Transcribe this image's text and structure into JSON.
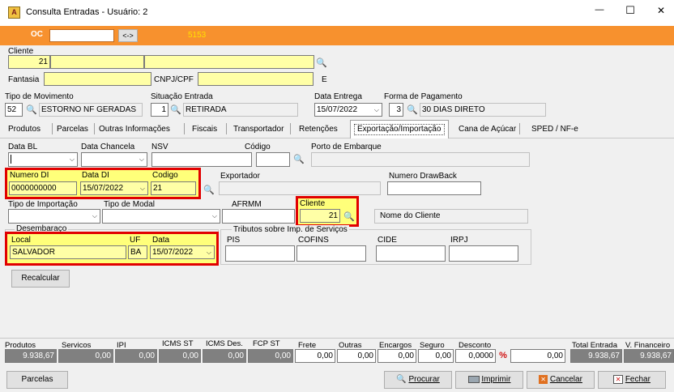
{
  "window": {
    "title": "Consulta Entradas - Usuário: 2",
    "controls": {
      "minimize": "—",
      "maximize": "☐",
      "close": "✕"
    }
  },
  "topbar": {
    "oc_label": "OC",
    "oc_button": "<->",
    "oc_number": "5153",
    "color": "#f7912e"
  },
  "client": {
    "section_label": "Cliente",
    "code": "21",
    "name": "",
    "fantasia_label": "Fantasia",
    "fantasia": "",
    "cnpj_label": "CNPJ/CPF",
    "cnpj": "",
    "e_label": "E"
  },
  "movement": {
    "tipo_label": "Tipo  de Movimento",
    "tipo_code": "52",
    "tipo_desc": "ESTORNO NF GERADAS",
    "situacao_label": "Situação Entrada",
    "situacao_code": "1",
    "situacao_desc": "RETIRADA",
    "data_entrega_label": "Data Entrega",
    "data_entrega": "15/07/2022",
    "forma_pag_label": "Forma de Pagamento",
    "forma_pag_code": "3",
    "forma_pag_desc": "30 DIAS DIRETO"
  },
  "tabs": [
    {
      "label": "Produtos"
    },
    {
      "label": "Parcelas"
    },
    {
      "label": "Outras Informações"
    },
    {
      "label": "Fiscais"
    },
    {
      "label": "Transportador"
    },
    {
      "label": "Retenções"
    },
    {
      "label": "Exportação/Importação"
    },
    {
      "label": "Cana de Açúcar"
    },
    {
      "label": "SPED / NF-e"
    }
  ],
  "export": {
    "data_bl_label": "Data BL",
    "data_chancela_label": "Data Chancela",
    "nsv_label": "NSV",
    "codigo_label": "Código",
    "porto_label": "Porto de Embarque",
    "numero_di_label": "Numero DI",
    "numero_di": "0000000000",
    "data_di_label": "Data DI",
    "data_di": "15/07/2022",
    "codigo2_label": "Codigo",
    "codigo2": "21",
    "exportador_label": "Exportador",
    "drawback_label": "Numero DrawBack",
    "tipo_importacao_label": "Tipo de Importação",
    "tipo_modal_label": "Tipo de Modal",
    "afrmm_label": "AFRMM",
    "cliente_label": "Cliente",
    "cliente_code": "21",
    "nome_cliente_label": "Nome do Cliente",
    "desembaraco_label": "Desembaraço",
    "local_label": "Local",
    "local": "SALVADOR",
    "uf_label": "UF",
    "uf": "BA",
    "data_label": "Data",
    "data": "15/07/2022",
    "tributos_label": "Tributos sobre Imp. de Serviços",
    "pis_label": "PIS",
    "cofins_label": "COFINS",
    "cide_label": "CIDE",
    "irpj_label": "IRPJ",
    "recalcular": "Recalcular"
  },
  "totals": {
    "produtos_label": "Produtos",
    "produtos": "9.938,67",
    "servicos_label": "Servicos",
    "servicos": "0,00",
    "ipi_label": "IPI",
    "ipi": "0,00",
    "icms_st_label": "ICMS ST",
    "icms_st": "0,00",
    "icms_des_label": "ICMS Des.",
    "icms_des": "0,00",
    "fcp_st_label": "FCP ST",
    "fcp_st": "0,00",
    "frete_label": "Frete",
    "frete": "0,00",
    "outras_label": "Outras",
    "outras": "0,00",
    "encargos_label": "Encargos",
    "encargos": "0,00",
    "seguro_label": "Seguro",
    "seguro": "0,00",
    "desconto_label": "Desconto",
    "desconto_pct": "0,0000",
    "desconto": "0,00",
    "total_entrada_label": "Total Entrada",
    "total_entrada": "9.938,67",
    "v_financeiro_label": "V. Financeiro",
    "v_financeiro": "9.938,67"
  },
  "buttons": {
    "parcelas": "Parcelas",
    "procurar": "Procurar",
    "imprimir": "Imprimir",
    "cancelar": "Cancelar",
    "fechar": "Fechar"
  },
  "icons": [
    "app-icon",
    "binoculars-icon",
    "dropdown-arrow-icon",
    "printer-icon",
    "cancel-icon",
    "close-doc-icon",
    "percent-icon"
  ]
}
